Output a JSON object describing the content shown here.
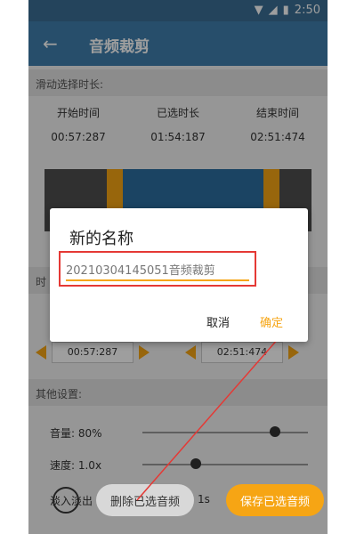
{
  "status": {
    "time": "2:50"
  },
  "appbar": {
    "title": "音频裁剪"
  },
  "section_select": {
    "label": "滑动选择时长:"
  },
  "times": [
    {
      "label": "开始时间",
      "value": "00:57:287"
    },
    {
      "label": "已选时长",
      "value": "01:54:187"
    },
    {
      "label": "结束时间",
      "value": "02:51:474"
    }
  ],
  "fine_tune": {
    "label_partial": "时",
    "start_value": "00:57:287",
    "end_value": "02:51:474"
  },
  "other_settings": {
    "label": "其他设置:"
  },
  "volume": {
    "label": "音量: 80%",
    "level": 0.8
  },
  "speed": {
    "label": "速度: 1.0x"
  },
  "fade": {
    "label": "淡入淡出",
    "value": "1s"
  },
  "buttons": {
    "delete": "删除已选音频",
    "save": "保存已选音频"
  },
  "dialog": {
    "title": "新的名称",
    "input_value": "20210304145051音频裁剪",
    "cancel": "取消",
    "ok": "确定"
  },
  "colors": {
    "accent": "#f6a514",
    "appbar": "#3f7ead",
    "highlight": "#e53935"
  }
}
